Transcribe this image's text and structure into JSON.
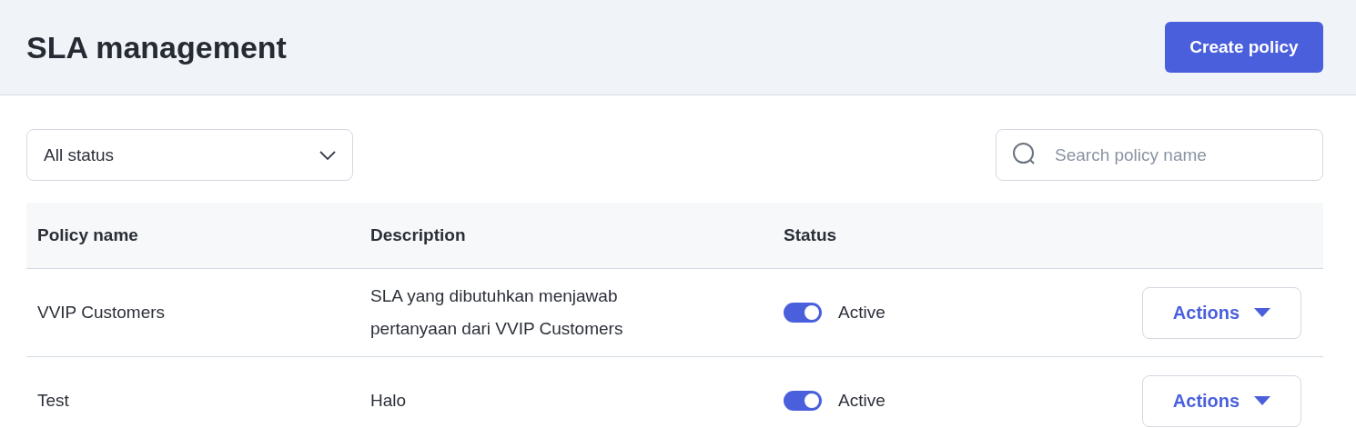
{
  "header": {
    "title": "SLA management",
    "create_button": "Create policy"
  },
  "filter": {
    "value": "All status"
  },
  "search": {
    "placeholder": "Search policy name"
  },
  "table": {
    "columns": [
      "Policy name",
      "Description",
      "Status"
    ],
    "rows": [
      {
        "name": "VVIP Customers",
        "description": "SLA yang dibutuhkan menjawab pertanyaan dari VVIP Customers",
        "active": true,
        "status": "Active",
        "action": "Actions"
      },
      {
        "name": "Test",
        "description": "Halo",
        "active": true,
        "status": "Active",
        "action": "Actions"
      }
    ]
  }
}
